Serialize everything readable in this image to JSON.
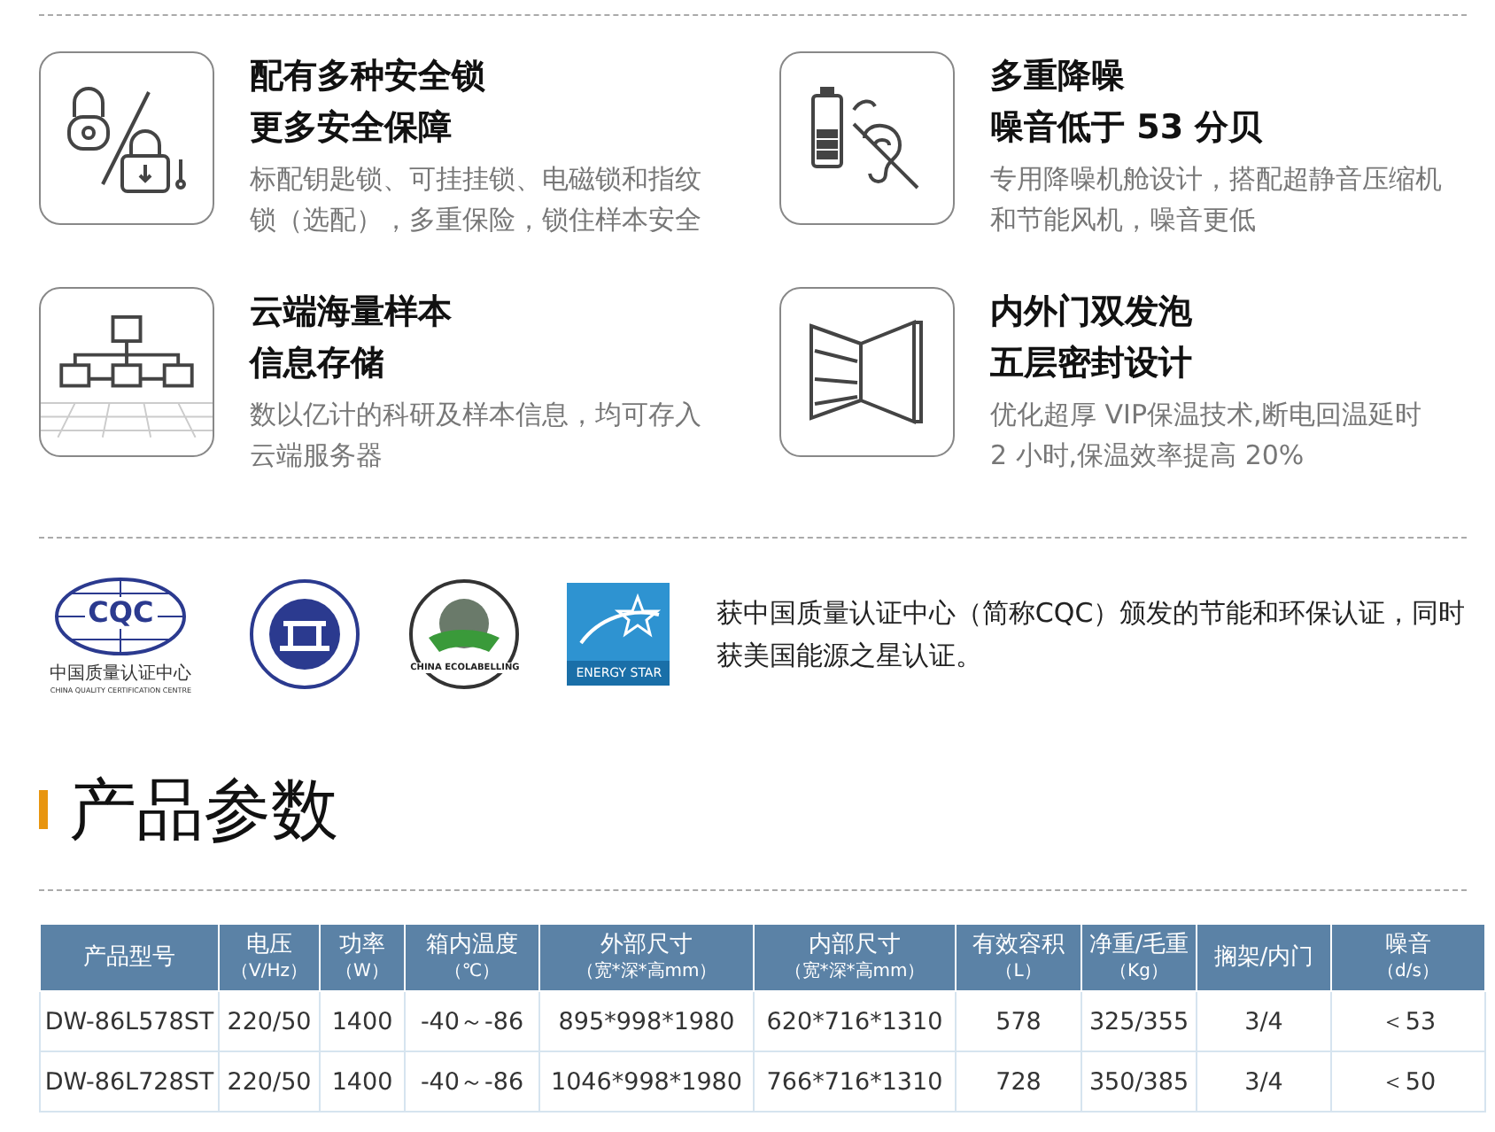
{
  "features": [
    {
      "title_lines": [
        "配有多种安全锁",
        "更多安全保障"
      ],
      "description": "标配钥匙锁、可挂挂锁、电磁锁和指纹锁（选配），多重保险，锁住样本安全"
    },
    {
      "title_lines": [
        "多重降噪",
        "噪音低于 53 分贝"
      ],
      "description": "专用降噪机舱设计，搭配超静音压缩机和节能风机，噪音更低"
    },
    {
      "title_lines": [
        "云端海量样本",
        "信息存储"
      ],
      "description": "数以亿计的科研及样本信息，均可存入云端服务器"
    },
    {
      "title_lines": [
        "内外门双发泡",
        "五层密封设计"
      ],
      "description": "优化超厚 VIP保温技术,断电回温延时 2 小时,保温效率提高 20%"
    }
  ],
  "certifications": {
    "logos": [
      {
        "kind": "cqc",
        "mark": "CQC",
        "caption": "中国质量认证中心",
        "subcaption": "CHINA QUALITY CERTIFICATION CENTRE"
      },
      {
        "kind": "energy-conservation"
      },
      {
        "kind": "ecolabel",
        "caption": "CHINA ECOLABELLING"
      },
      {
        "kind": "energy-star",
        "caption": "ENERGY STAR"
      }
    ],
    "text": "获中国质量认证中心（简称CQC）颁发的节能和环保认证，同时获美国能源之星认证。"
  },
  "section_title": "产品参数",
  "table": {
    "columns": [
      {
        "label": "产品型号"
      },
      {
        "label": "电压",
        "unit": "（V/Hz）"
      },
      {
        "label": "功率",
        "unit": "（W）"
      },
      {
        "label": "箱内温度",
        "unit": "（℃）"
      },
      {
        "label": "外部尺寸",
        "unit": "（宽*深*高mm）"
      },
      {
        "label": "内部尺寸",
        "unit": "（宽*深*高mm）"
      },
      {
        "label": "有效容积",
        "unit": "（L）"
      },
      {
        "label": "净重/毛重",
        "unit": "（Kg）"
      },
      {
        "label": "搁架/内门"
      },
      {
        "label": "噪音",
        "unit": "（d/s）"
      }
    ],
    "rows": [
      [
        "DW-86L578ST",
        "220/50",
        "1400",
        "-40～-86",
        "895*998*1980",
        "620*716*1310",
        "578",
        "325/355",
        "3/4",
        "＜53"
      ],
      [
        "DW-86L728ST",
        "220/50",
        "1400",
        "-40～-86",
        "1046*998*1980",
        "766*716*1310",
        "728",
        "350/385",
        "3/4",
        "＜50"
      ]
    ]
  }
}
